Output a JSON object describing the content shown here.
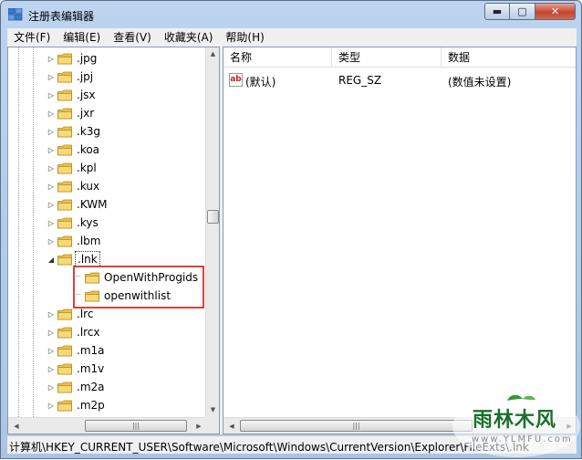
{
  "window": {
    "title": "注册表编辑器",
    "caption": {
      "minimize": "▬",
      "maximize": "▢",
      "close": "✕"
    }
  },
  "menu": [
    "文件(F)",
    "编辑(E)",
    "查看(V)",
    "收藏夹(A)",
    "帮助(H)"
  ],
  "tree": {
    "items": [
      ".jpg",
      ".jpj",
      ".jsx",
      ".jxr",
      ".k3g",
      ".koa",
      ".kpl",
      ".kux",
      ".KWM",
      ".kys",
      ".lbm",
      ".lnk",
      "OpenWithProgids",
      "openwithlist",
      ".lrc",
      ".lrcx",
      ".m1a",
      ".m1v",
      ".m2a",
      ".m2p"
    ],
    "selected": ".lnk"
  },
  "values": {
    "columns": [
      "名称",
      "类型",
      "数据"
    ],
    "rows": [
      {
        "icon": "ab",
        "name": "(默认)",
        "type": "REG_SZ",
        "data": "(数值未设置)"
      }
    ]
  },
  "status": {
    "path": "计算机\\HKEY_CURRENT_USER\\Software\\Microsoft\\Windows\\CurrentVersion\\Explorer\\FileExts\\.lnk"
  },
  "watermark": {
    "name": "雨林木风",
    "url": "www.YLMFU.com"
  },
  "colors": {
    "highlight": "#d6453d",
    "watermark": "#1b6f2c"
  }
}
